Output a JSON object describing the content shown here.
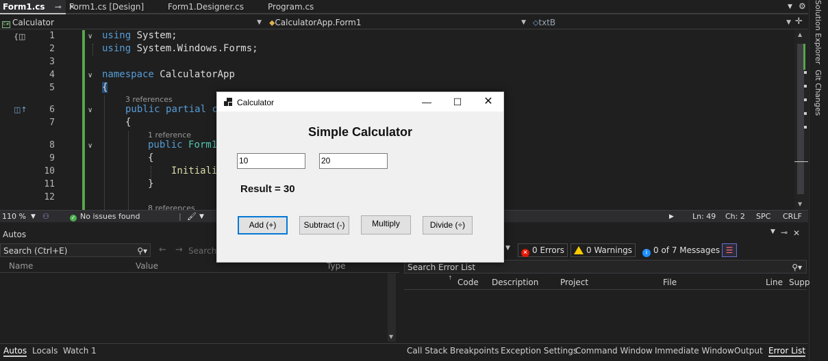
{
  "tabs": [
    {
      "label": "Form1.cs",
      "active": true
    },
    {
      "label": "Form1.cs [Design]"
    },
    {
      "label": "Form1.Designer.cs"
    },
    {
      "label": "Program.cs"
    }
  ],
  "navbar": {
    "project": "Calculator",
    "class": "CalculatorApp.Form1",
    "member": "txtB"
  },
  "editor": {
    "line_numbers": [
      "1",
      "2",
      "3",
      "4",
      "5",
      "6",
      "7",
      "8",
      "9",
      "10",
      "11",
      "12"
    ],
    "references": {
      "r6": "3 references",
      "r8": "1 reference",
      "r13": "8 references"
    },
    "tokens": {
      "using": "using",
      "system": "System;",
      "system_forms": "System.Windows.Forms;",
      "namespace": "namespace",
      "ns_name": "CalculatorApp",
      "brace_open": "{",
      "brace_close": "}",
      "public": "public",
      "partial": "partial",
      "c": "c",
      "form1": "Form1",
      "initiali": "Initiali"
    }
  },
  "status": {
    "zoom": "110 %",
    "issues": "No issues found",
    "ln": "Ln: 49",
    "ch": "Ch: 2",
    "spc": "SPC",
    "crlf": "CRLF"
  },
  "autos": {
    "title": "Autos",
    "search_placeholder": "Search (Ctrl+E)",
    "search_depth": "Search D",
    "columns": [
      "Name",
      "Value",
      "Type"
    ]
  },
  "error_list": {
    "errors": "0 Errors",
    "warnings": "0 Warnings",
    "messages": "0 of 7 Messages",
    "search_placeholder": "Search Error List",
    "columns": [
      "Code",
      "Description",
      "Project",
      "File",
      "Line",
      "Supp"
    ]
  },
  "bottom_tabs_left": [
    "Autos",
    "Locals",
    "Watch 1"
  ],
  "bottom_tabs_right": [
    "Call Stack",
    "Breakpoints",
    "Exception Settings",
    "Command Window",
    "Immediate Window",
    "Output",
    "Error List"
  ],
  "rail": [
    "Solution Explorer",
    "Git Changes"
  ],
  "calculator": {
    "window_title": "Calculator",
    "heading": "Simple Calculator",
    "input_a": "10",
    "input_b": "20",
    "result": "Result = 30",
    "buttons": {
      "add": "Add (+)",
      "subtract": "Subtract (-)",
      "multiply": "Multiply",
      "divide": "Divide (÷)"
    }
  },
  "colors": {
    "editor_bg": "#1f1f1f",
    "keyword": "#569cd6",
    "type": "#4ec9b0",
    "change_bar": "#57a64a",
    "accent": "#0078d7"
  }
}
